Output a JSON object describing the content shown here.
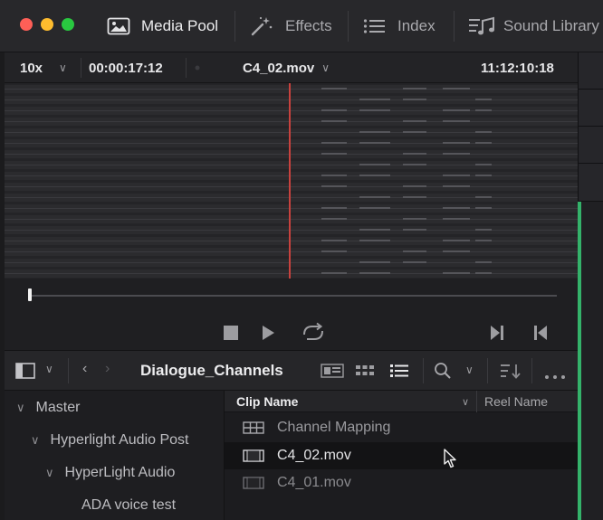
{
  "app": {
    "colors": {
      "accent_meter": "#34b26a",
      "playhead": "#c8423e",
      "window_close": "#fe5f57",
      "window_minimize": "#febc2e",
      "window_zoom": "#29c840"
    }
  },
  "topbar": {
    "tabs": [
      {
        "label": "Media Pool",
        "icon": "media-pool-icon",
        "active": true
      },
      {
        "label": "Effects",
        "icon": "effects-wand-icon",
        "active": false
      },
      {
        "label": "Index",
        "icon": "index-list-icon",
        "active": false
      },
      {
        "label": "Sound Library",
        "icon": "sound-library-icon",
        "active": false
      }
    ]
  },
  "viewer": {
    "zoom": "10x",
    "source_timecode": "00:00:17:12",
    "clip_name": "C4_02.mov",
    "record_timecode": "11:12:10:18",
    "scrub_position": 0.0
  },
  "media_pool": {
    "bin_name": "Dialogue_Channels",
    "tree": [
      {
        "label": "Master",
        "level": 0,
        "expanded": true
      },
      {
        "label": "Hyperlight Audio Post",
        "level": 1,
        "expanded": true
      },
      {
        "label": "HyperLight Audio",
        "level": 2,
        "expanded": true
      },
      {
        "label": "ADA voice test",
        "level": 3,
        "expanded": false
      }
    ],
    "columns": {
      "clip_name": "Clip Name",
      "reel_name": "Reel Name"
    },
    "clips": [
      {
        "name": "Channel Mapping",
        "icon": "channel-mapping-icon",
        "selected": false
      },
      {
        "name": "C4_02.mov",
        "icon": "film-clip-icon",
        "selected": true
      },
      {
        "name": "C4_01.mov",
        "icon": "film-clip-icon",
        "selected": false
      }
    ]
  }
}
